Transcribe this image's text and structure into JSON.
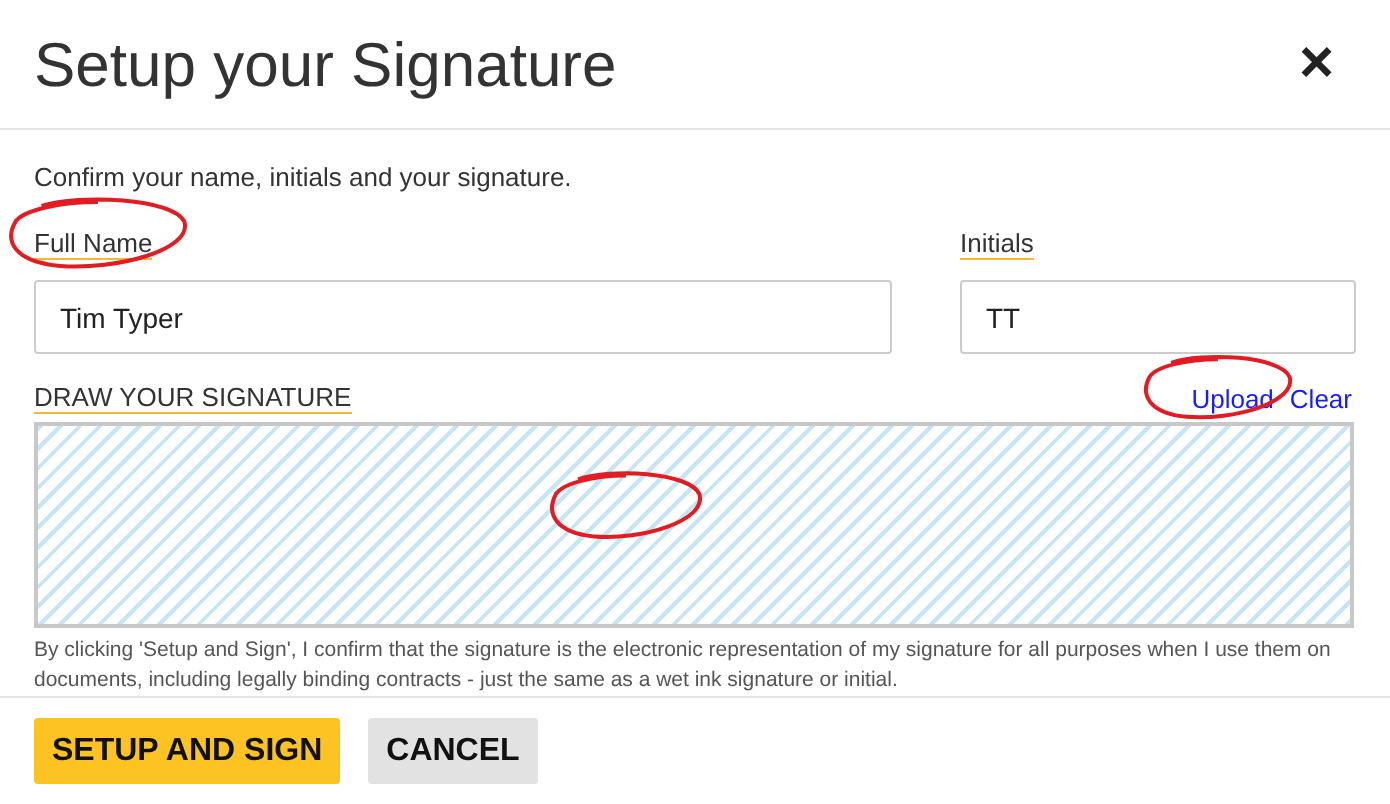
{
  "dialog": {
    "title": "Setup your Signature",
    "close": "×"
  },
  "intro": "Confirm your name, initials and your signature.",
  "fields": [
    {
      "label": "Full Name",
      "value": "Tim Typer"
    },
    {
      "label": "Initials",
      "value": "TT"
    }
  ],
  "signature": {
    "label": "DRAW YOUR SIGNATURE",
    "actions": [
      "Upload",
      "Clear"
    ]
  },
  "disclaimer": "By clicking 'Setup and Sign', I confirm that the signature is the electronic representation of my signature for all purposes when I use them on documents, including legally binding contracts - just the same as a wet ink signature or initial.",
  "buttons": [
    {
      "label": "SETUP AND SIGN",
      "kind": "primary"
    },
    {
      "label": "CANCEL",
      "kind": "secondary"
    }
  ]
}
